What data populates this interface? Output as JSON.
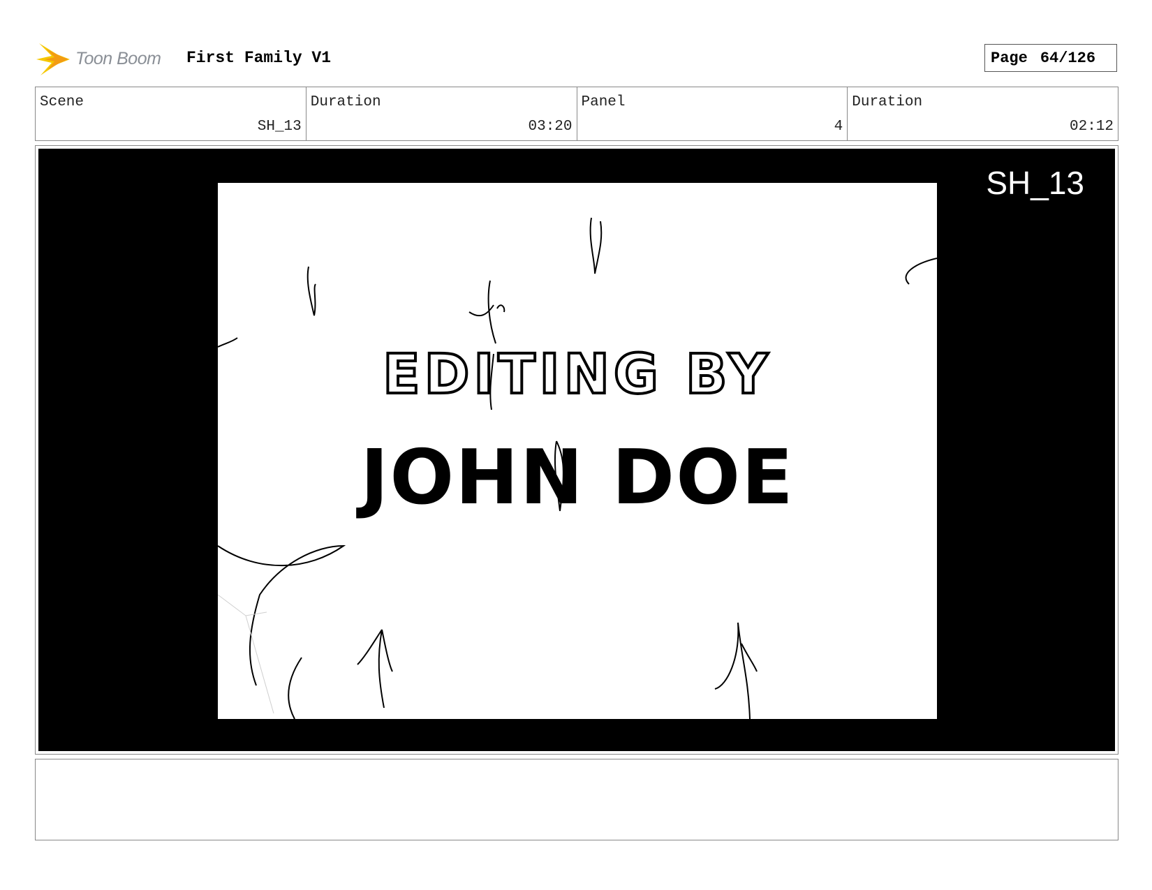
{
  "header": {
    "brand": "Toon Boom",
    "project_title": "First Family V1",
    "page_label": "Page",
    "page_value": "64/126"
  },
  "info": {
    "scene_label": "Scene",
    "scene_value": "SH_13",
    "scene_duration_label": "Duration",
    "scene_duration_value": "03:20",
    "panel_label": "Panel",
    "panel_value": "4",
    "panel_duration_label": "Duration",
    "panel_duration_value": "02:12"
  },
  "panel": {
    "scene_tag": "SH_13",
    "title_line1": "EDITING BY",
    "title_line2": "JOHN DOE"
  },
  "notes": {
    "text": ""
  }
}
